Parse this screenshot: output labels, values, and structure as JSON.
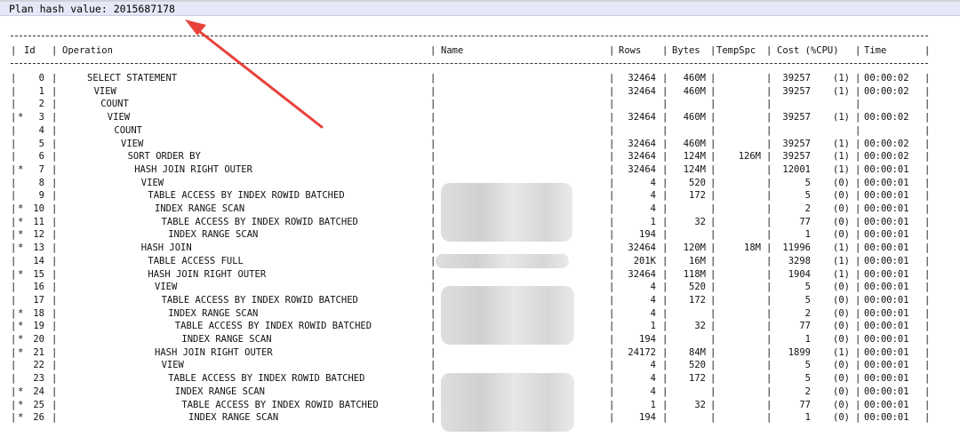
{
  "plan_hash_label": "Plan hash value: 2015687178",
  "columns": {
    "id": "Id",
    "operation": "Operation",
    "name": "Name",
    "rows": "Rows",
    "bytes": "Bytes",
    "tempspc": "TempSpc",
    "cost": "Cost (%CPU)",
    "time": "Time"
  },
  "rows": [
    {
      "star": "",
      "id": "0",
      "op": "SELECT STATEMENT",
      "indent": 0,
      "rows": "32464",
      "bytes": "460M",
      "temp": "",
      "cost": "39257",
      "cpu": "(1)",
      "time": "00:00:02"
    },
    {
      "star": "",
      "id": "1",
      "op": "VIEW",
      "indent": 1,
      "rows": "32464",
      "bytes": "460M",
      "temp": "",
      "cost": "39257",
      "cpu": "(1)",
      "time": "00:00:02"
    },
    {
      "star": "",
      "id": "2",
      "op": "COUNT",
      "indent": 2,
      "rows": "",
      "bytes": "",
      "temp": "",
      "cost": "",
      "cpu": "",
      "time": ""
    },
    {
      "star": "*",
      "id": "3",
      "op": "VIEW",
      "indent": 3,
      "rows": "32464",
      "bytes": "460M",
      "temp": "",
      "cost": "39257",
      "cpu": "(1)",
      "time": "00:00:02"
    },
    {
      "star": "",
      "id": "4",
      "op": "COUNT",
      "indent": 4,
      "rows": "",
      "bytes": "",
      "temp": "",
      "cost": "",
      "cpu": "",
      "time": ""
    },
    {
      "star": "",
      "id": "5",
      "op": "VIEW",
      "indent": 5,
      "rows": "32464",
      "bytes": "460M",
      "temp": "",
      "cost": "39257",
      "cpu": "(1)",
      "time": "00:00:02"
    },
    {
      "star": "",
      "id": "6",
      "op": "SORT ORDER BY",
      "indent": 6,
      "rows": "32464",
      "bytes": "124M",
      "temp": "126M",
      "cost": "39257",
      "cpu": "(1)",
      "time": "00:00:02"
    },
    {
      "star": "*",
      "id": "7",
      "op": "HASH JOIN RIGHT OUTER",
      "indent": 7,
      "rows": "32464",
      "bytes": "124M",
      "temp": "",
      "cost": "12001",
      "cpu": "(1)",
      "time": "00:00:01"
    },
    {
      "star": "",
      "id": "8",
      "op": "VIEW",
      "indent": 8,
      "rows": "4",
      "bytes": "520",
      "temp": "",
      "cost": "5",
      "cpu": "(0)",
      "time": "00:00:01"
    },
    {
      "star": "",
      "id": "9",
      "op": "TABLE ACCESS BY INDEX ROWID BATCHED",
      "indent": 9,
      "rows": "4",
      "bytes": "172",
      "temp": "",
      "cost": "5",
      "cpu": "(0)",
      "time": "00:00:01"
    },
    {
      "star": "*",
      "id": "10",
      "op": "INDEX RANGE SCAN",
      "indent": 10,
      "rows": "4",
      "bytes": "",
      "temp": "",
      "cost": "2",
      "cpu": "(0)",
      "time": "00:00:01"
    },
    {
      "star": "*",
      "id": "11",
      "op": "TABLE ACCESS BY INDEX ROWID BATCHED",
      "indent": 11,
      "rows": "1",
      "bytes": "32",
      "temp": "",
      "cost": "77",
      "cpu": "(0)",
      "time": "00:00:01"
    },
    {
      "star": "*",
      "id": "12",
      "op": "INDEX RANGE SCAN",
      "indent": 12,
      "rows": "194",
      "bytes": "",
      "temp": "",
      "cost": "1",
      "cpu": "(0)",
      "time": "00:00:01"
    },
    {
      "star": "*",
      "id": "13",
      "op": "HASH JOIN",
      "indent": 8,
      "rows": "32464",
      "bytes": "120M",
      "temp": "18M",
      "cost": "11996",
      "cpu": "(1)",
      "time": "00:00:01"
    },
    {
      "star": "",
      "id": "14",
      "op": "TABLE ACCESS FULL",
      "indent": 9,
      "rows": "201K",
      "bytes": "16M",
      "temp": "",
      "cost": "3298",
      "cpu": "(1)",
      "time": "00:00:01"
    },
    {
      "star": "*",
      "id": "15",
      "op": "HASH JOIN RIGHT OUTER",
      "indent": 9,
      "rows": "32464",
      "bytes": "118M",
      "temp": "",
      "cost": "1904",
      "cpu": "(1)",
      "time": "00:00:01"
    },
    {
      "star": "",
      "id": "16",
      "op": "VIEW",
      "indent": 10,
      "rows": "4",
      "bytes": "520",
      "temp": "",
      "cost": "5",
      "cpu": "(0)",
      "time": "00:00:01"
    },
    {
      "star": "",
      "id": "17",
      "op": "TABLE ACCESS BY INDEX ROWID BATCHED",
      "indent": 11,
      "rows": "4",
      "bytes": "172",
      "temp": "",
      "cost": "5",
      "cpu": "(0)",
      "time": "00:00:01"
    },
    {
      "star": "*",
      "id": "18",
      "op": "INDEX RANGE SCAN",
      "indent": 12,
      "rows": "4",
      "bytes": "",
      "temp": "",
      "cost": "2",
      "cpu": "(0)",
      "time": "00:00:01"
    },
    {
      "star": "*",
      "id": "19",
      "op": "TABLE ACCESS BY INDEX ROWID BATCHED",
      "indent": 13,
      "rows": "1",
      "bytes": "32",
      "temp": "",
      "cost": "77",
      "cpu": "(0)",
      "time": "00:00:01"
    },
    {
      "star": "*",
      "id": "20",
      "op": "INDEX RANGE SCAN",
      "indent": 14,
      "rows": "194",
      "bytes": "",
      "temp": "",
      "cost": "1",
      "cpu": "(0)",
      "time": "00:00:01"
    },
    {
      "star": "*",
      "id": "21",
      "op": "HASH JOIN RIGHT OUTER",
      "indent": 10,
      "rows": "24172",
      "bytes": "84M",
      "temp": "",
      "cost": "1899",
      "cpu": "(1)",
      "time": "00:00:01"
    },
    {
      "star": "",
      "id": "22",
      "op": "VIEW",
      "indent": 11,
      "rows": "4",
      "bytes": "520",
      "temp": "",
      "cost": "5",
      "cpu": "(0)",
      "time": "00:00:01"
    },
    {
      "star": "",
      "id": "23",
      "op": "TABLE ACCESS BY INDEX ROWID BATCHED",
      "indent": 12,
      "rows": "4",
      "bytes": "172",
      "temp": "",
      "cost": "5",
      "cpu": "(0)",
      "time": "00:00:01"
    },
    {
      "star": "*",
      "id": "24",
      "op": "INDEX RANGE SCAN",
      "indent": 13,
      "rows": "4",
      "bytes": "",
      "temp": "",
      "cost": "2",
      "cpu": "(0)",
      "time": "00:00:01"
    },
    {
      "star": "*",
      "id": "25",
      "op": "TABLE ACCESS BY INDEX ROWID BATCHED",
      "indent": 14,
      "rows": "1",
      "bytes": "32",
      "temp": "",
      "cost": "77",
      "cpu": "(0)",
      "time": "00:00:01"
    },
    {
      "star": "*",
      "id": "26",
      "op": "INDEX RANGE SCAN",
      "indent": 15,
      "rows": "194",
      "bytes": "",
      "temp": "",
      "cost": "1",
      "cpu": "(0)",
      "time": "00:00:01"
    }
  ],
  "annotation_color": "#e8413a"
}
